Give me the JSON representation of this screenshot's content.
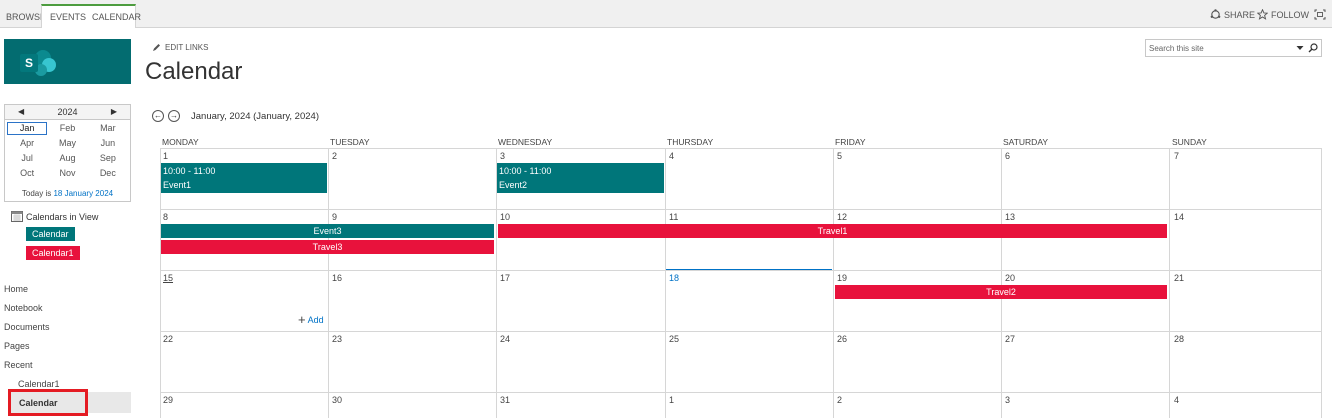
{
  "ribbon": {
    "tabs": [
      "BROWSE",
      "EVENTS",
      "CALENDAR"
    ],
    "share": "SHARE",
    "follow": "FOLLOW"
  },
  "header": {
    "edit_links": "EDIT LINKS",
    "title": "Calendar",
    "search_placeholder": "Search this site"
  },
  "picker": {
    "year": "2024",
    "months": [
      "Jan",
      "Feb",
      "Mar",
      "Apr",
      "May",
      "Jun",
      "Jul",
      "Aug",
      "Sep",
      "Oct",
      "Nov",
      "Dec"
    ],
    "selected_month": "Jan",
    "today_prefix": "Today is ",
    "today_link": "18 January 2024"
  },
  "calendars_in_view": {
    "label": "Calendars in View",
    "items": [
      {
        "label": "Calendar",
        "color": "#00767a"
      },
      {
        "label": "Calendar1",
        "color": "#e8123c"
      }
    ]
  },
  "nav": {
    "items": [
      "Home",
      "Notebook",
      "Documents",
      "Pages",
      "Recent"
    ],
    "recent": [
      "Calendar1",
      "Calendar"
    ]
  },
  "calendar": {
    "month_label": "January, 2024 (January, 2024)",
    "day_headers": [
      "MONDAY",
      "TUESDAY",
      "WEDNESDAY",
      "THURSDAY",
      "FRIDAY",
      "SATURDAY",
      "SUNDAY"
    ],
    "weeks": [
      [
        "1",
        "2",
        "3",
        "4",
        "5",
        "6",
        "7"
      ],
      [
        "8",
        "9",
        "10",
        "11",
        "12",
        "13",
        "14"
      ],
      [
        "15",
        "16",
        "17",
        "18",
        "19",
        "20",
        "21"
      ],
      [
        "22",
        "23",
        "24",
        "25",
        "26",
        "27",
        "28"
      ],
      [
        "29",
        "30",
        "31",
        "1",
        "2",
        "3",
        "4"
      ]
    ],
    "today": "18",
    "add_label": "Add",
    "events": [
      {
        "time": "10:00 - 11:00",
        "title": "Event1"
      },
      {
        "time": "10:00 - 11:00",
        "title": "Event2"
      }
    ],
    "bars": [
      "Event3",
      "Travel3",
      "Travel1",
      "Travel2"
    ],
    "colors": {
      "calendar": "#00767a",
      "calendar1": "#e8123c",
      "today": "#0072c6"
    }
  }
}
